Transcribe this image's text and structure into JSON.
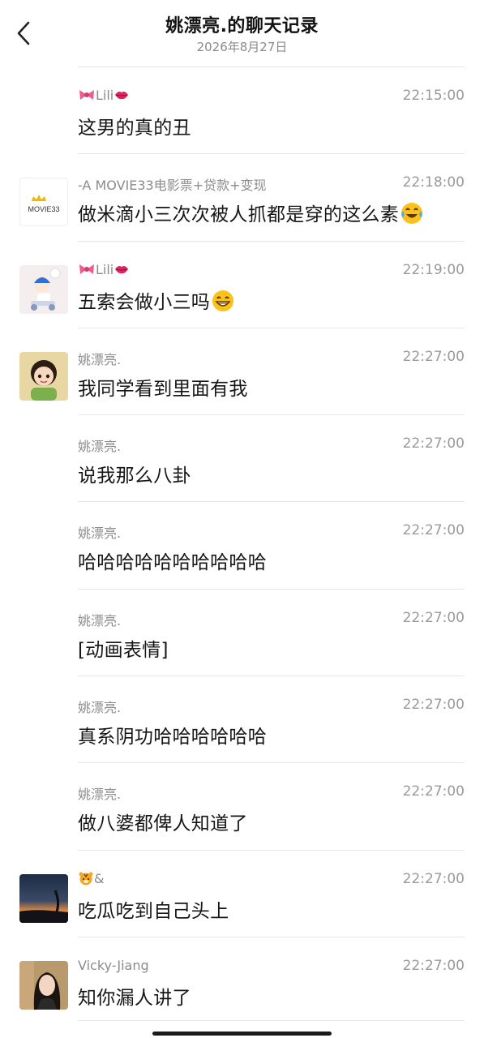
{
  "header": {
    "title": "姚漂亮.的聊天记录",
    "date": "2026年8月27日"
  },
  "messages": [
    {
      "sender": "Lili",
      "time": "22:15:00",
      "text": "这男的真的丑",
      "avatar": "none",
      "emoji": ""
    },
    {
      "sender": "-A MOVIE33电影票+贷款+变现",
      "time": "22:18:00",
      "text": "做米滴小三次次被人抓都是穿的这么素",
      "avatar": "movie33-logo",
      "avatar_text": "MOVIE33",
      "emoji": "laughing-tears"
    },
    {
      "sender": "Lili",
      "time": "22:19:00",
      "text": "五索会做小三吗",
      "avatar": "cartoon-scooter",
      "emoji": "grinning"
    },
    {
      "sender": "姚漂亮.",
      "time": "22:27:00",
      "text": "我同学看到里面有我",
      "avatar": "cartoon-girl",
      "emoji": ""
    },
    {
      "sender": "姚漂亮.",
      "time": "22:27:00",
      "text": "说我那么八卦",
      "avatar": "none",
      "emoji": ""
    },
    {
      "sender": "姚漂亮.",
      "time": "22:27:00",
      "text": "哈哈哈哈哈哈哈哈哈哈",
      "avatar": "none",
      "emoji": ""
    },
    {
      "sender": "姚漂亮.",
      "time": "22:27:00",
      "text": "[动画表情]",
      "avatar": "none",
      "emoji": ""
    },
    {
      "sender": "姚漂亮.",
      "time": "22:27:00",
      "text": "真系阴功哈哈哈哈哈哈",
      "avatar": "none",
      "emoji": ""
    },
    {
      "sender": "姚漂亮.",
      "time": "22:27:00",
      "text": "做八婆都俾人知道了",
      "avatar": "none",
      "emoji": ""
    },
    {
      "sender": "&",
      "time": "22:27:00",
      "text": "吃瓜吃到自己头上",
      "avatar": "sunset-photo",
      "emoji": ""
    },
    {
      "sender": "Vicky-Jiang",
      "time": "22:27:00",
      "text": "知你漏人讲了",
      "avatar": "woman-photo",
      "emoji": ""
    }
  ],
  "colors": {
    "text": "#161616",
    "meta": "#8c8c8c",
    "separator": "#e6e6e6"
  }
}
